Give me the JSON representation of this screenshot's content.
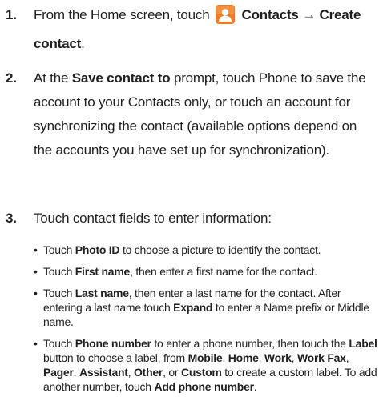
{
  "steps": [
    {
      "number": "1.",
      "pre": "From the Home screen, touch",
      "contacts": "Contacts",
      "arrow": "→",
      "create": "Create contact",
      "post": "."
    },
    {
      "number": "2.",
      "pre": "At the",
      "bold": "Save contact to",
      "post": "prompt, touch Phone to save the account to your Contacts only, or touch an account for synchronizing the contact (available options depend on the accounts you have set up for synchronization)."
    },
    {
      "number": "3.",
      "text": "Touch contact fields to enter information:"
    }
  ],
  "bullets": {
    "b1": {
      "t1": "Touch",
      "b1": "Photo ID",
      "t2": "to choose a picture to identify the contact."
    },
    "b2": {
      "t1": "Touch",
      "b1": "First name",
      "t2": ", then enter a first name for the contact."
    },
    "b3": {
      "t1": "Touch",
      "b1": "Last name",
      "t2": ", then enter a last name for the contact. After entering a last name touch",
      "b2": "Expand",
      "t3": "to enter a Name prefix or Middle name."
    },
    "b4": {
      "t1": "Touch",
      "b1": "Phone number",
      "t2": "to enter a phone number, then touch the",
      "b2": "Label",
      "t3": "button to choose a label, from",
      "b3": "Mobile",
      "s1": ",",
      "b4": "Home",
      "s2": ",",
      "b5": "Work",
      "s3": ",",
      "b6": "Work Fax",
      "s4": ",",
      "b7": "Pager",
      "s5": ",",
      "b8": "Assistant",
      "s6": ",",
      "b9": "Other",
      "s7": ", or",
      "b10": "Custom",
      "t4": "to create a custom label. To add another number, touch",
      "b11": "Add phone number",
      "t5": "."
    }
  },
  "icons": {
    "contacts_icon": "contacts-person-icon",
    "icon_color": "#f07b22"
  }
}
